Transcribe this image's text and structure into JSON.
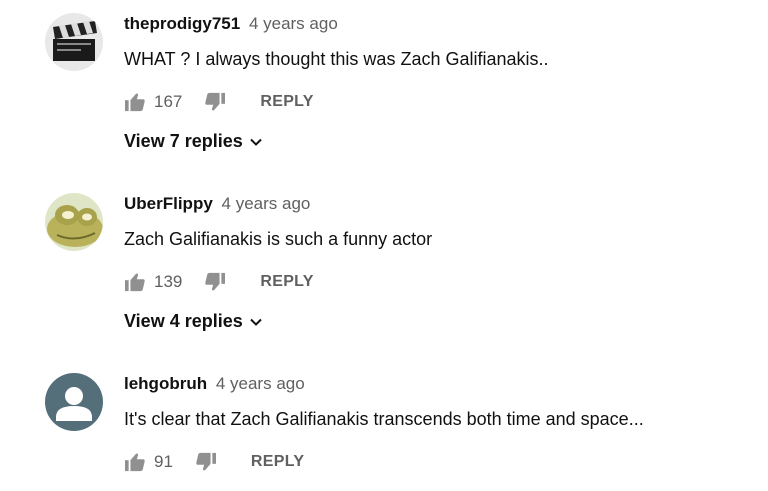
{
  "comments": [
    {
      "author": "theprodigy751",
      "time": "4 years ago",
      "text": "WHAT ? I always thought this was Zach Galifianakis..",
      "likes": "167",
      "reply_label": "REPLY",
      "view_replies_label": "View 7 replies",
      "avatar": "clapperboard-avatar"
    },
    {
      "author": "UberFlippy",
      "time": "4 years ago",
      "text": "Zach Galifianakis is such a funny actor",
      "likes": "139",
      "reply_label": "REPLY",
      "view_replies_label": "View 4 replies",
      "avatar": "frog-avatar"
    },
    {
      "author": "lehgobruh",
      "time": "4 years ago",
      "text": "It's clear that Zach Galifianakis transcends both time and space...",
      "likes": "91",
      "reply_label": "REPLY",
      "avatar": "default-user-avatar"
    }
  ],
  "icons": {
    "like": "thumbs-up-icon",
    "dislike": "thumbs-down-icon",
    "expand": "chevron-down-icon"
  },
  "colors": {
    "text": "#111111",
    "meta": "#606060",
    "icon": "#909090",
    "default_avatar_bg": "#546e7a"
  }
}
